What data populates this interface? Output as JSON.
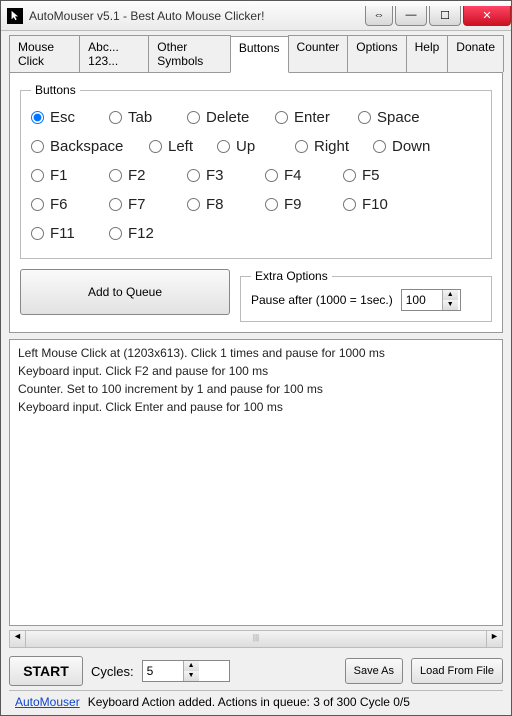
{
  "window": {
    "title": "AutoMouser v5.1 - Best Auto Mouse Clicker!"
  },
  "tabs": [
    "Mouse Click",
    "Abc... 123...",
    "Other Symbols",
    "Buttons",
    "Counter",
    "Options",
    "Help",
    "Donate"
  ],
  "active_tab": 3,
  "buttons_group": {
    "legend": "Buttons",
    "options": [
      "Esc",
      "Tab",
      "Delete",
      "Enter",
      "Space",
      "Backspace",
      "Left",
      "Up",
      "Right",
      "Down",
      "F1",
      "F2",
      "F3",
      "F4",
      "F5",
      "F6",
      "F7",
      "F8",
      "F9",
      "F10",
      "F11",
      "F12"
    ],
    "selected": "Esc"
  },
  "add_to_queue": "Add to Queue",
  "extra": {
    "legend": "Extra Options",
    "pause_label": "Pause after (1000 = 1sec.)",
    "pause_value": "100"
  },
  "queue": [
    "Left Mouse Click at  (1203x613). Click 1 times and pause for 1000 ms",
    "Keyboard input. Click F2 and pause for 100 ms",
    "Counter. Set to 100 increment by 1 and pause for 100 ms",
    "Keyboard input. Click Enter and pause for 100 ms"
  ],
  "start": "START",
  "cycles_label": "Cycles:",
  "cycles_value": "5",
  "save_as": "Save As",
  "load_from_file": "Load From File",
  "status": {
    "link": "AutoMouser",
    "text": "Keyboard Action added. Actions in queue: 3 of 300  Cycle 0/5"
  }
}
